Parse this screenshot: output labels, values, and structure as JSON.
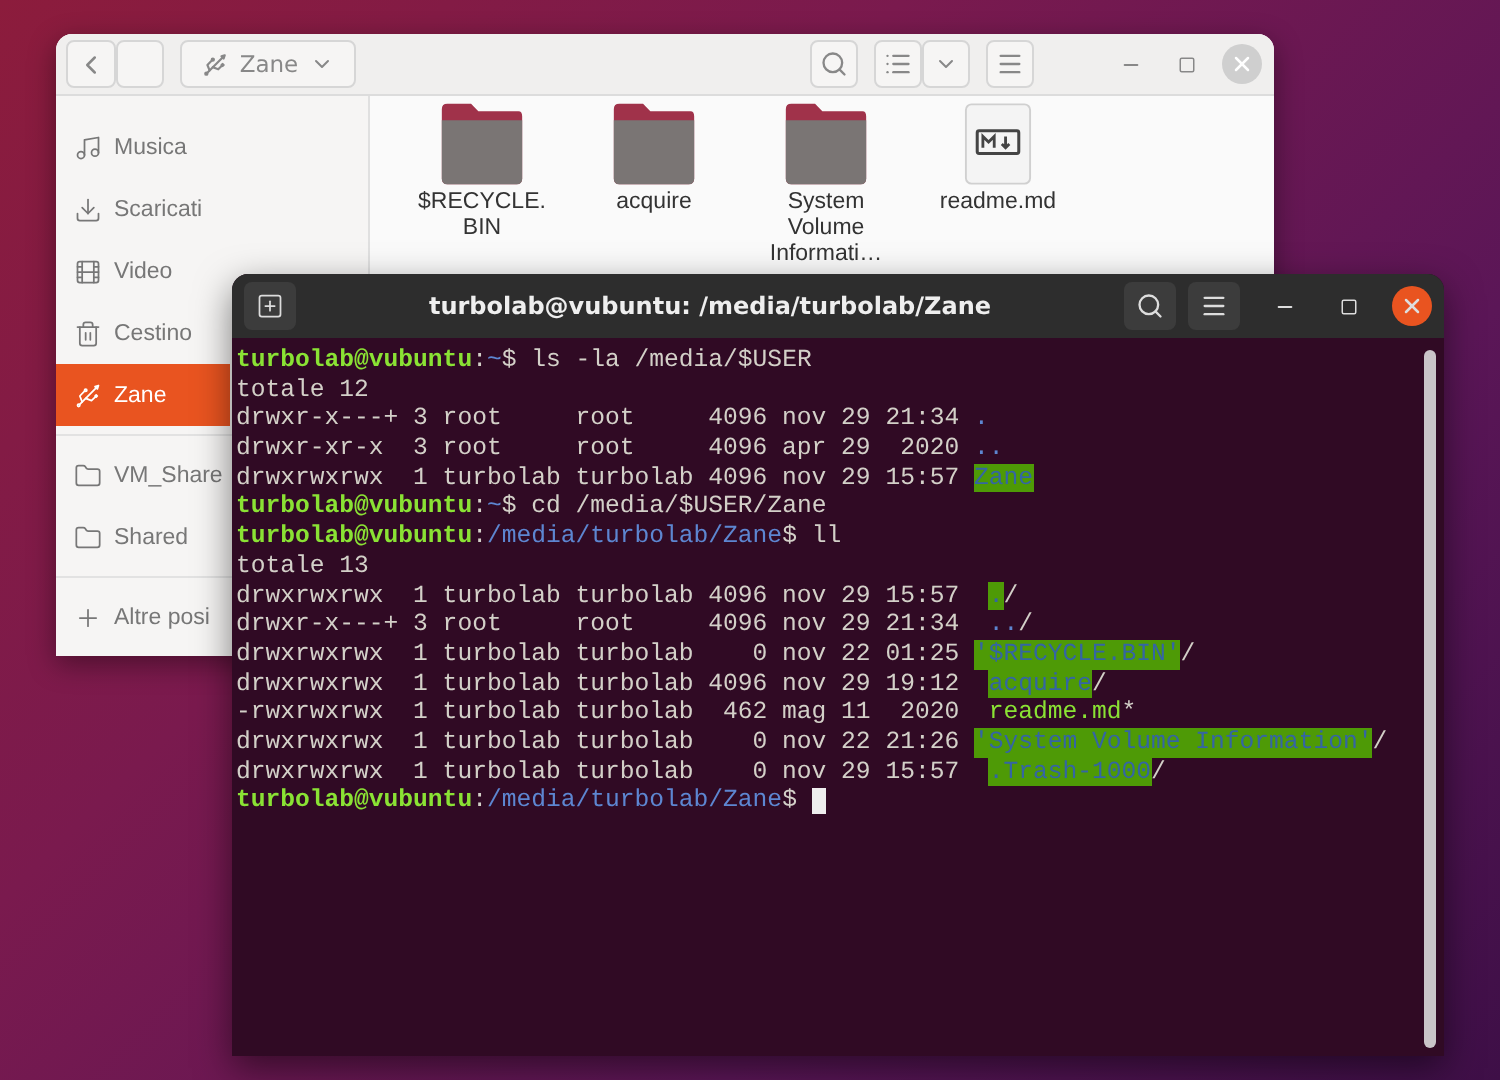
{
  "file_manager": {
    "location": "Zane",
    "sidebar": [
      {
        "items": [
          {
            "label": "Musica",
            "kind": "music",
            "selected": false
          },
          {
            "label": "Scaricati",
            "kind": "download",
            "selected": false
          },
          {
            "label": "Video",
            "kind": "video",
            "selected": false
          },
          {
            "label": "Cestino",
            "kind": "trash",
            "selected": false
          },
          {
            "label": "Zane",
            "kind": "usb",
            "selected": true
          }
        ]
      },
      {
        "items": [
          {
            "label": "VM_Share",
            "kind": "folder",
            "selected": false
          },
          {
            "label": "Shared",
            "kind": "folder",
            "selected": false
          }
        ]
      },
      {
        "items": [
          {
            "label": "Altre posi",
            "kind": "add",
            "selected": false
          }
        ]
      }
    ],
    "files": [
      {
        "name": "$RECYCLE.BIN",
        "kind": "folder"
      },
      {
        "name": "acquire",
        "kind": "folder"
      },
      {
        "name": "System Volume Informati…",
        "kind": "folder"
      },
      {
        "name": "readme.md",
        "kind": "markdown"
      }
    ]
  },
  "terminal": {
    "title": "turbolab@vubuntu: /media/turbolab/Zane",
    "lines": [
      [
        {
          "text": "turbolab@vubuntu",
          "kind": "prompt"
        },
        {
          "text": ":",
          "kind": "plain"
        },
        {
          "text": "~",
          "kind": "path"
        },
        {
          "text": "$ ls -la /media/$USER",
          "kind": "plain"
        }
      ],
      [
        {
          "text": "totale 12",
          "kind": "plain"
        }
      ],
      [
        {
          "text": "drwxr-x---+ 3 root     root     4096 nov 29 21:34 ",
          "kind": "plain"
        },
        {
          "text": ".",
          "kind": "dir"
        }
      ],
      [
        {
          "text": "drwxr-xr-x  3 root     root     4096 apr 29  2020 ",
          "kind": "plain"
        },
        {
          "text": "..",
          "kind": "dir"
        }
      ],
      [
        {
          "text": "drwxrwxrwx  1 turbolab turbolab 4096 nov 29 15:57 ",
          "kind": "plain"
        },
        {
          "text": "Zane",
          "kind": "shared_dir"
        }
      ],
      [
        {
          "text": "turbolab@vubuntu",
          "kind": "prompt"
        },
        {
          "text": ":",
          "kind": "plain"
        },
        {
          "text": "~",
          "kind": "path"
        },
        {
          "text": "$ cd /media/$USER/Zane",
          "kind": "plain"
        }
      ],
      [
        {
          "text": "turbolab@vubuntu",
          "kind": "prompt"
        },
        {
          "text": ":",
          "kind": "plain"
        },
        {
          "text": "/media/turbolab/Zane",
          "kind": "path"
        },
        {
          "text": "$ ll",
          "kind": "plain"
        }
      ],
      [
        {
          "text": "totale 13",
          "kind": "plain"
        }
      ],
      [
        {
          "text": "drwxrwxrwx  1 turbolab turbolab 4096 nov 29 15:57  ",
          "kind": "plain"
        },
        {
          "text": ".",
          "kind": "shared_dir"
        },
        {
          "text": "/",
          "kind": "plain"
        }
      ],
      [
        {
          "text": "drwxr-x---+ 3 root     root     4096 nov 29 21:34  ",
          "kind": "plain"
        },
        {
          "text": "..",
          "kind": "dir"
        },
        {
          "text": "/",
          "kind": "plain"
        }
      ],
      [
        {
          "text": "drwxrwxrwx  1 turbolab turbolab    0 nov 22 01:25 ",
          "kind": "plain"
        },
        {
          "text": "'$RECYCLE.BIN'",
          "kind": "shared_dir"
        },
        {
          "text": "/",
          "kind": "plain"
        }
      ],
      [
        {
          "text": "drwxrwxrwx  1 turbolab turbolab 4096 nov 29 19:12  ",
          "kind": "plain"
        },
        {
          "text": "acquire",
          "kind": "shared_dir"
        },
        {
          "text": "/",
          "kind": "plain"
        }
      ],
      [
        {
          "text": "-rwxrwxrwx  1 turbolab turbolab  462 mag 11  2020  ",
          "kind": "plain"
        },
        {
          "text": "readme.md",
          "kind": "exec"
        },
        {
          "text": "*",
          "kind": "plain"
        }
      ],
      [
        {
          "text": "drwxrwxrwx  1 turbolab turbolab    0 nov 22 21:26 ",
          "kind": "plain"
        },
        {
          "text": "'System Volume Information'",
          "kind": "shared_dir"
        },
        {
          "text": "/",
          "kind": "plain"
        }
      ],
      [
        {
          "text": "drwxrwxrwx  1 turbolab turbolab    0 nov 29 15:57  ",
          "kind": "plain"
        },
        {
          "text": ".Trash-1000",
          "kind": "shared_dir"
        },
        {
          "text": "/",
          "kind": "plain"
        }
      ],
      [
        {
          "text": "turbolab@vubuntu",
          "kind": "prompt"
        },
        {
          "text": ":",
          "kind": "plain"
        },
        {
          "text": "/media/turbolab/Zane",
          "kind": "path"
        },
        {
          "text": "$ ",
          "kind": "plain"
        }
      ]
    ]
  }
}
